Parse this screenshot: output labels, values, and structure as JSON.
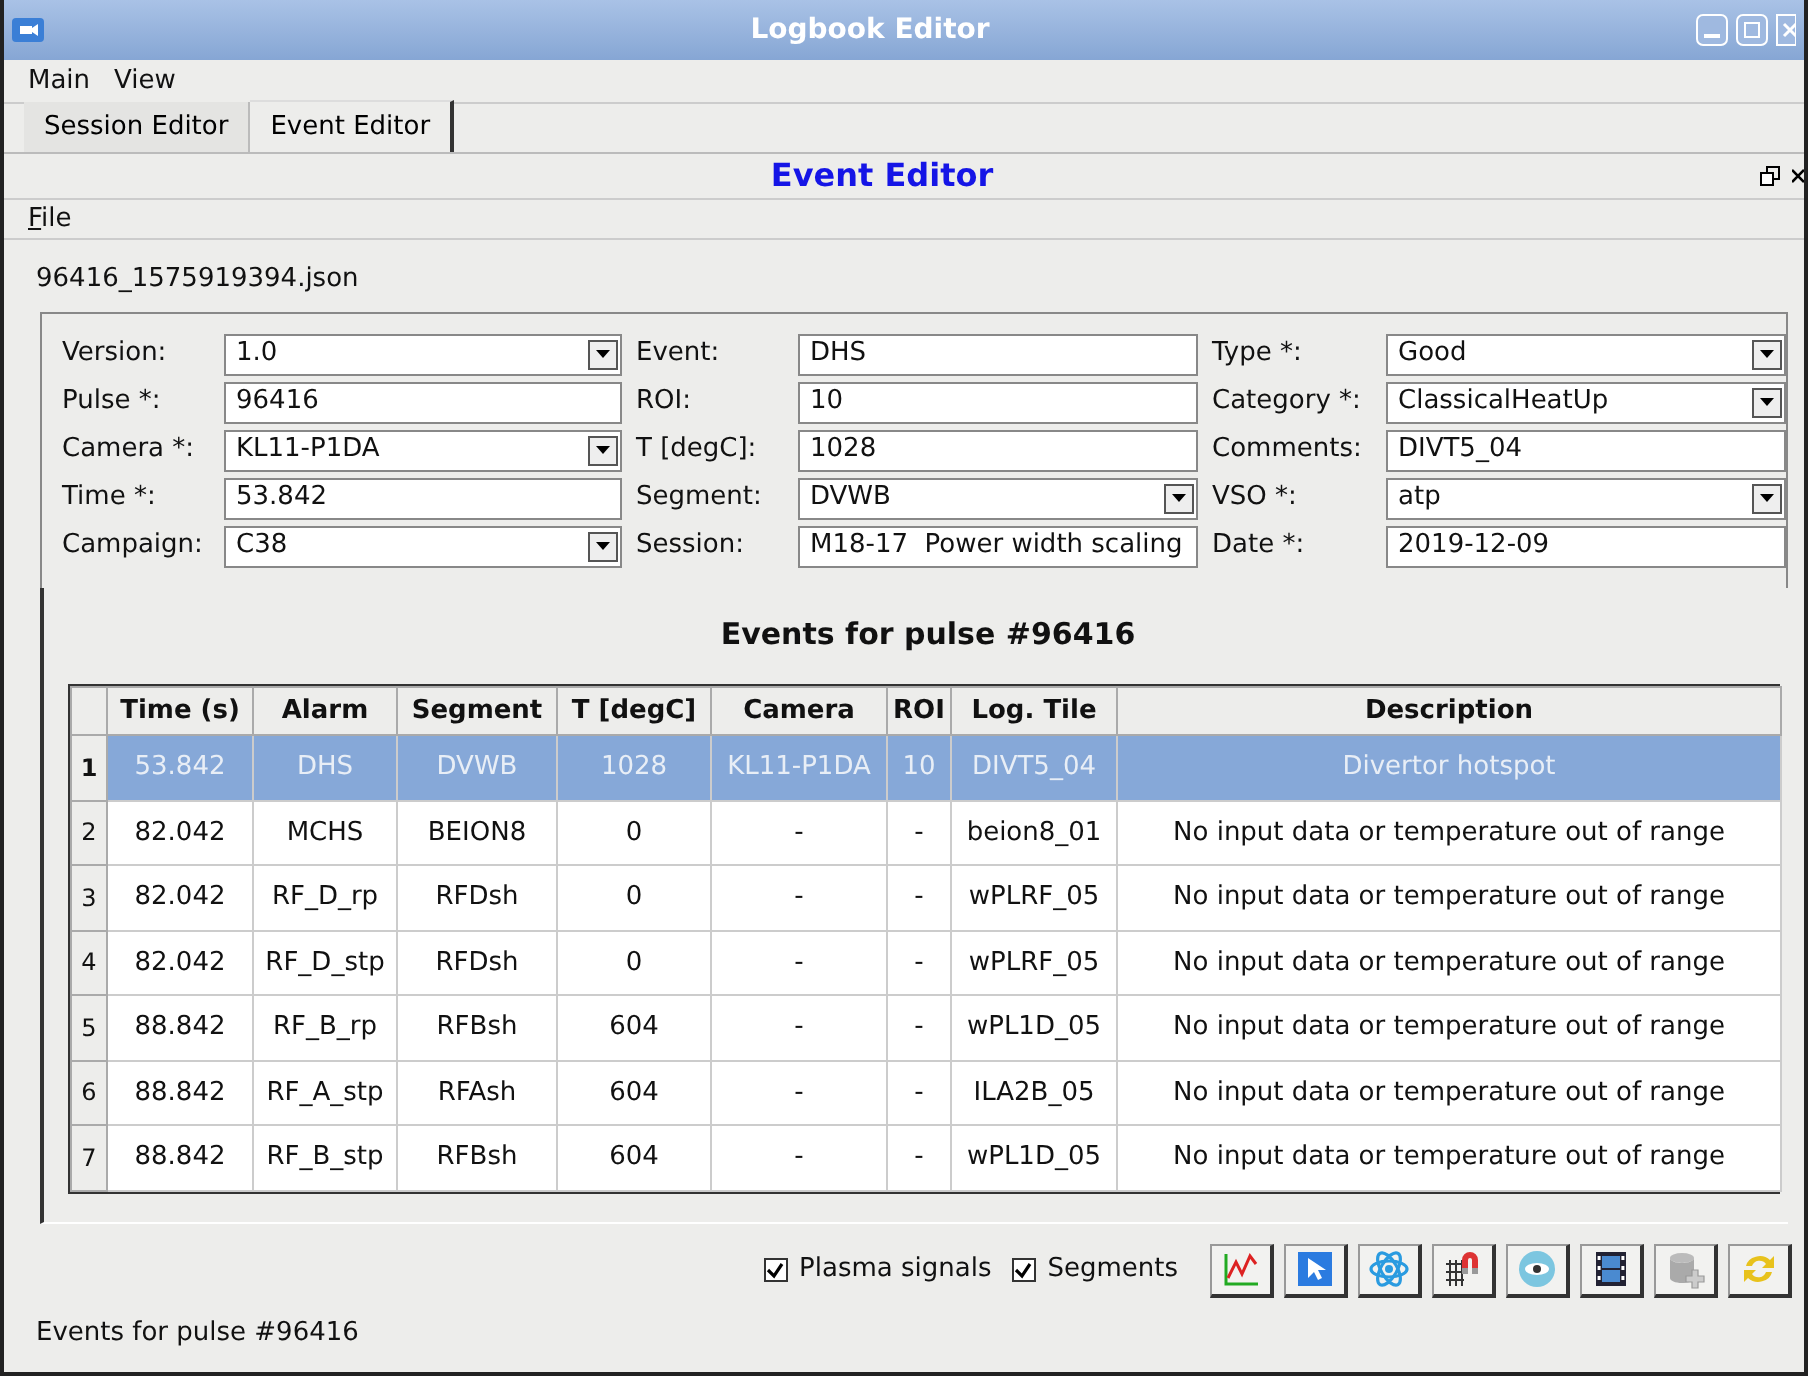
{
  "window": {
    "title": "Logbook Editor"
  },
  "menu": [
    "Main",
    "View"
  ],
  "tabs": [
    {
      "label": "Session Editor",
      "selected": false
    },
    {
      "label": "Event Editor",
      "selected": true
    }
  ],
  "panel": {
    "title": "Event Editor",
    "menu": [
      "File"
    ]
  },
  "file_name": "96416_1575919394.json",
  "form": [
    [
      {
        "label": "Version:",
        "value": "1.0",
        "kind": "combo"
      },
      {
        "label": "Pulse *:",
        "value": "96416",
        "kind": "text"
      },
      {
        "label": "Camera *:",
        "value": "KL11-P1DA",
        "kind": "combo"
      },
      {
        "label": "Time *:",
        "value": "53.842",
        "kind": "text"
      },
      {
        "label": "Campaign:",
        "value": "C38",
        "kind": "combo"
      }
    ],
    [
      {
        "label": "Event:",
        "value": "DHS",
        "kind": "text"
      },
      {
        "label": "ROI:",
        "value": "10",
        "kind": "text"
      },
      {
        "label": "T [degC]:",
        "value": "1028",
        "kind": "text"
      },
      {
        "label": "Segment:",
        "value": "DVWB",
        "kind": "combo"
      },
      {
        "label": "Session:",
        "value": "M18-17  Power width scaling",
        "kind": "text"
      }
    ],
    [
      {
        "label": "Type *:",
        "value": "Good",
        "kind": "combo"
      },
      {
        "label": "Category *:",
        "value": "ClassicalHeatUp",
        "kind": "combo"
      },
      {
        "label": "Comments:",
        "value": "DIVT5_04",
        "kind": "text"
      },
      {
        "label": "VSO *:",
        "value": "atp",
        "kind": "combo"
      },
      {
        "label": "Date *:",
        "value": "2019-12-09",
        "kind": "text"
      }
    ]
  ],
  "events": {
    "title": "Events for pulse #96416",
    "columns": [
      "Time (s)",
      "Alarm",
      "Segment",
      "T [degC]",
      "Camera",
      "ROI",
      "Log. Tile",
      "Description"
    ],
    "rows": [
      {
        "number": "1",
        "selected": true,
        "cells": [
          "53.842",
          "DHS",
          "DVWB",
          "1028",
          "KL11-P1DA",
          "10",
          "DIVT5_04",
          "Divertor hotspot"
        ]
      },
      {
        "number": "2",
        "selected": false,
        "cells": [
          "82.042",
          "MCHS",
          "BEION8",
          "0",
          "-",
          "-",
          "beion8_01",
          "No input data or temperature out of range"
        ]
      },
      {
        "number": "3",
        "selected": false,
        "cells": [
          "82.042",
          "RF_D_rp",
          "RFDsh",
          "0",
          "-",
          "-",
          "wPLRF_05",
          "No input data or temperature out of range"
        ]
      },
      {
        "number": "4",
        "selected": false,
        "cells": [
          "82.042",
          "RF_D_stp",
          "RFDsh",
          "0",
          "-",
          "-",
          "wPLRF_05",
          "No input data or temperature out of range"
        ]
      },
      {
        "number": "5",
        "selected": false,
        "cells": [
          "88.842",
          "RF_B_rp",
          "RFBsh",
          "604",
          "-",
          "-",
          "wPL1D_05",
          "No input data or temperature out of range"
        ]
      },
      {
        "number": "6",
        "selected": false,
        "cells": [
          "88.842",
          "RF_A_stp",
          "RFAsh",
          "604",
          "-",
          "-",
          "ILA2B_05",
          "No input data or temperature out of range"
        ]
      },
      {
        "number": "7",
        "selected": false,
        "cells": [
          "88.842",
          "RF_B_stp",
          "RFBsh",
          "604",
          "-",
          "-",
          "wPL1D_05",
          "No input data or temperature out of range"
        ]
      }
    ]
  },
  "options": [
    {
      "label": "Plasma signals",
      "checked": true
    },
    {
      "label": "Segments",
      "checked": true
    }
  ],
  "toolbar": [
    {
      "kind": "chart"
    },
    {
      "kind": "cursor"
    },
    {
      "kind": "atom"
    },
    {
      "kind": "magnet"
    },
    {
      "kind": "eye"
    },
    {
      "kind": "film"
    },
    {
      "kind": "database"
    },
    {
      "kind": "refresh"
    }
  ],
  "status_bar": "Events for pulse #96416"
}
